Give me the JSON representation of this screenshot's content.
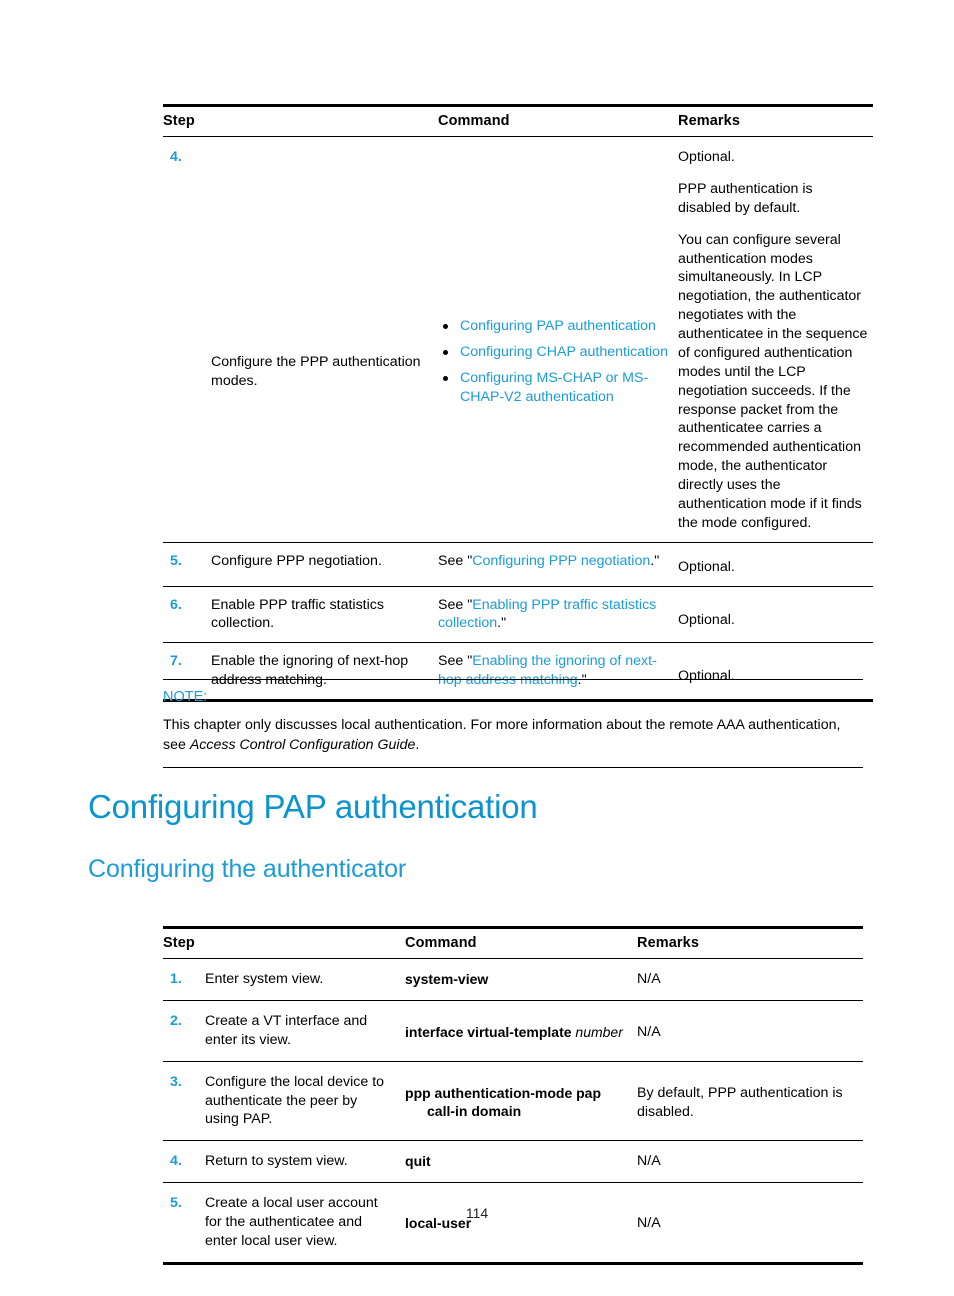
{
  "page": {
    "number": "114"
  },
  "table1": {
    "headers": [
      "Step",
      "Command",
      "Remarks"
    ],
    "rows": [
      {
        "step": "4.",
        "description": "Configure the PPP authentication modes.",
        "command_bullets": [
          "Configuring PAP authentication",
          "Configuring CHAP authentication",
          "Configuring MS-CHAP or MS-CHAP-V2 authentication"
        ],
        "remarks_paragraphs": [
          "Optional.",
          "PPP authentication is disabled by default.",
          "You can configure several authentication modes simultaneously. In LCP negotiation, the authenticator negotiates with the authenticatee in the sequence of configured authentication modes until the LCP negotiation succeeds. If the response packet from the authenticatee carries a recommended authentication mode, the authenticator directly uses the authentication mode if it finds the mode configured."
        ]
      },
      {
        "step": "5.",
        "description": "Configure PPP negotiation.",
        "command_prefix": "See \"",
        "command_link": "Configuring PPP negotiation",
        "command_suffix": ".\"",
        "remarks": "Optional."
      },
      {
        "step": "6.",
        "description": "Enable PPP traffic statistics collection.",
        "command_prefix": "See \"",
        "command_link": "Enabling PPP traffic statistics collection",
        "command_suffix": ".\"",
        "remarks": "Optional."
      },
      {
        "step": "7.",
        "description": "Enable the ignoring of next-hop address matching.",
        "command_prefix": "See \"",
        "command_link": "Enabling the ignoring of next-hop address matching",
        "command_suffix": ".\"",
        "remarks": "Optional."
      }
    ]
  },
  "note": {
    "label": "NOTE:",
    "text_before": "This chapter only discusses local authentication. For more information about the remote AAA authentication, see ",
    "italic_title": "Access Control Configuration Guide",
    "text_after": "."
  },
  "headings": {
    "h1": "Configuring PAP authentication",
    "h2": "Configuring the authenticator"
  },
  "table2": {
    "headers": [
      "Step",
      "Command",
      "Remarks"
    ],
    "rows": [
      {
        "step": "1.",
        "description": "Enter system view.",
        "command_bold": "system-view",
        "command_italic": "",
        "command_line2": "",
        "remarks": "N/A"
      },
      {
        "step": "2.",
        "description": "Create a VT interface and enter its view.",
        "command_bold": "interface virtual-template",
        "command_italic": " number",
        "command_line2": "",
        "remarks": "N/A"
      },
      {
        "step": "3.",
        "description": "Configure the local device to authenticate the peer by using PAP.",
        "command_bold": "ppp authentication-mode pap",
        "command_italic": "",
        "command_line2": "call-in   domain",
        "remarks": "By default, PPP authentication is disabled."
      },
      {
        "step": "4.",
        "description": "Return to system view.",
        "command_bold": "quit",
        "command_italic": "",
        "command_line2": "",
        "remarks": "N/A"
      },
      {
        "step": "5.",
        "description": "Create a local user account for the authenticatee and enter local user view.",
        "command_bold": "local-user",
        "command_italic": "",
        "command_line2": "",
        "remarks": "N/A"
      }
    ]
  },
  "colors": {
    "link_blue": "#1b9cd8",
    "heading_blue": "#0c94cf",
    "rule_black": "#000000"
  }
}
